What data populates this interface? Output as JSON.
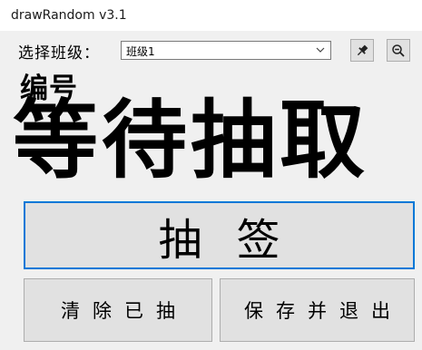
{
  "window": {
    "title": "drawRandom v3.1"
  },
  "class_select": {
    "label": "选择班级：",
    "value": "班级1"
  },
  "toolbar": {
    "pin_icon": "pin-icon",
    "zoom_icon": "zoom-out-icon"
  },
  "display": {
    "number_label": "编号",
    "result": "等待抽取"
  },
  "buttons": {
    "draw_label": "抽签",
    "clear_label": "清除已抽",
    "save_exit_label": "保存并退出"
  },
  "colors": {
    "focus_border": "#0078d7",
    "button_face": "#e1e1e1",
    "window_bg": "#f0f0f0"
  }
}
